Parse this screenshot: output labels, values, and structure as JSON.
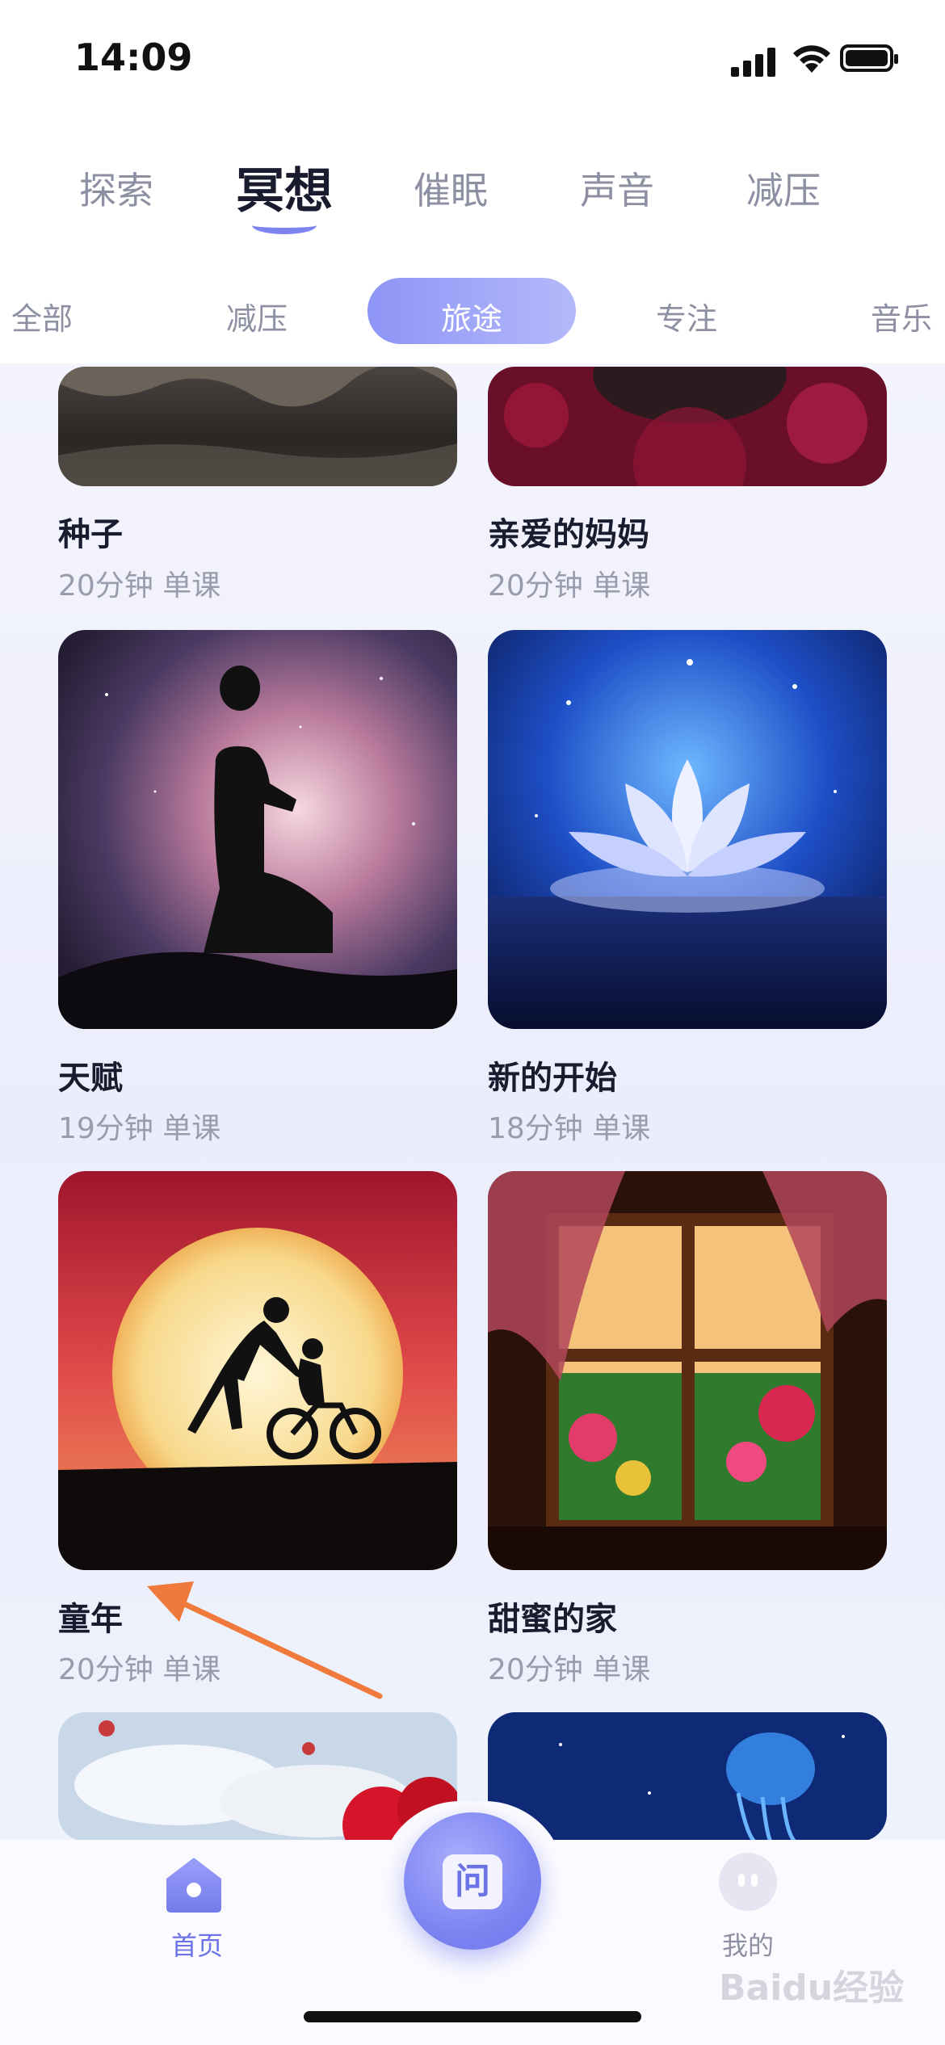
{
  "status_bar": {
    "time": "14:09"
  },
  "main_tabs": [
    {
      "label": "探索"
    },
    {
      "label": "冥想",
      "active": true
    },
    {
      "label": "催眠"
    },
    {
      "label": "声音"
    },
    {
      "label": "减压"
    }
  ],
  "sub_tabs": [
    {
      "label": "全部"
    },
    {
      "label": "减压"
    },
    {
      "label": "旅途",
      "active": true
    },
    {
      "label": "专注"
    },
    {
      "label": "音乐"
    }
  ],
  "courses": [
    {
      "title": "种子",
      "meta": "20分钟 单课"
    },
    {
      "title": "亲爱的妈妈",
      "meta": "20分钟 单课"
    },
    {
      "title": "天赋",
      "meta": "19分钟 单课"
    },
    {
      "title": "新的开始",
      "meta": "18分钟 单课"
    },
    {
      "title": "童年",
      "meta": "20分钟 单课"
    },
    {
      "title": "甜蜜的家",
      "meta": "20分钟 单课"
    }
  ],
  "bottom_nav": {
    "home_label": "首页",
    "center_label": "问",
    "me_label": "我的"
  },
  "watermark": "Baidu经验",
  "colors": {
    "accent": "#7d84f0",
    "arrow": "#f07a3c"
  }
}
